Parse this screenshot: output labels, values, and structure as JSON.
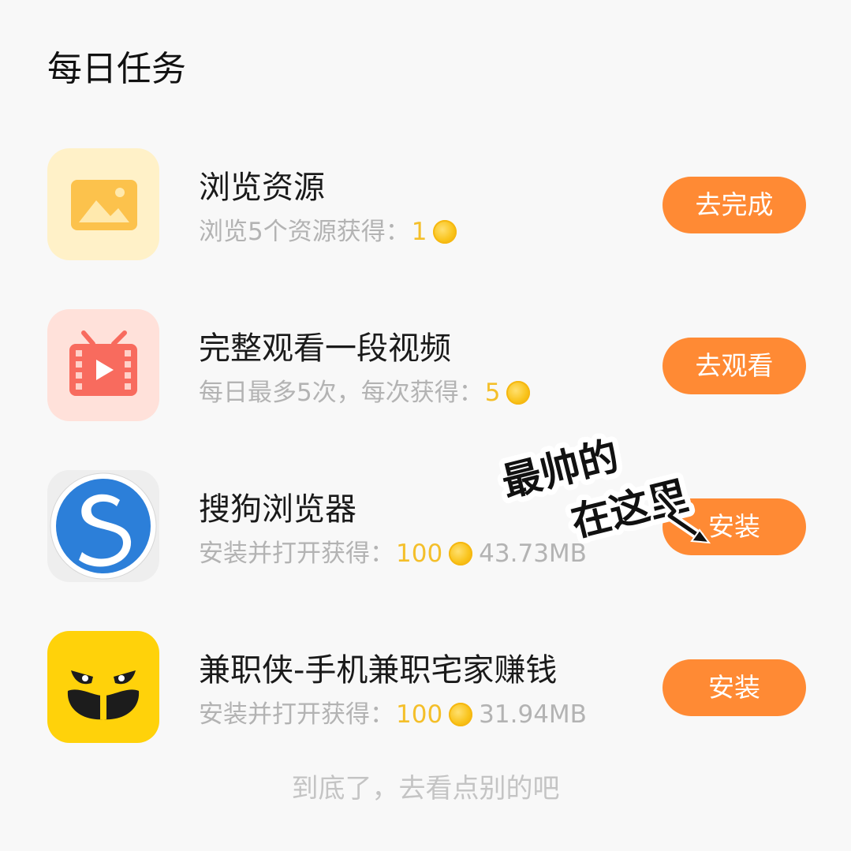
{
  "header": {
    "title": "每日任务"
  },
  "tasks": [
    {
      "title": "浏览资源",
      "desc": "浏览5个资源获得：",
      "reward": "1",
      "size": "",
      "button": "去完成",
      "icon": "image-icon"
    },
    {
      "title": "完整观看一段视频",
      "desc": "每日最多5次，每次获得：",
      "reward": "5",
      "size": "",
      "button": "去观看",
      "icon": "video-tv-icon"
    },
    {
      "title": "搜狗浏览器",
      "desc": "安装并打开获得：",
      "reward": "100",
      "size": "43.73MB",
      "button": "安装",
      "icon": "sogou-browser-icon"
    },
    {
      "title": "兼职侠-手机兼职宅家赚钱",
      "desc": "安装并打开获得：",
      "reward": "100",
      "size": "31.94MB",
      "button": "安装",
      "icon": "jianzhixia-app-icon"
    }
  ],
  "footer": {
    "text": "到底了，去看点别的吧"
  },
  "sticker": {
    "line1": "最帅的",
    "line2": "在这里"
  },
  "colors": {
    "accent": "#ff8a34",
    "coin": "#f4bf2a",
    "muted": "#b3b3b3"
  }
}
